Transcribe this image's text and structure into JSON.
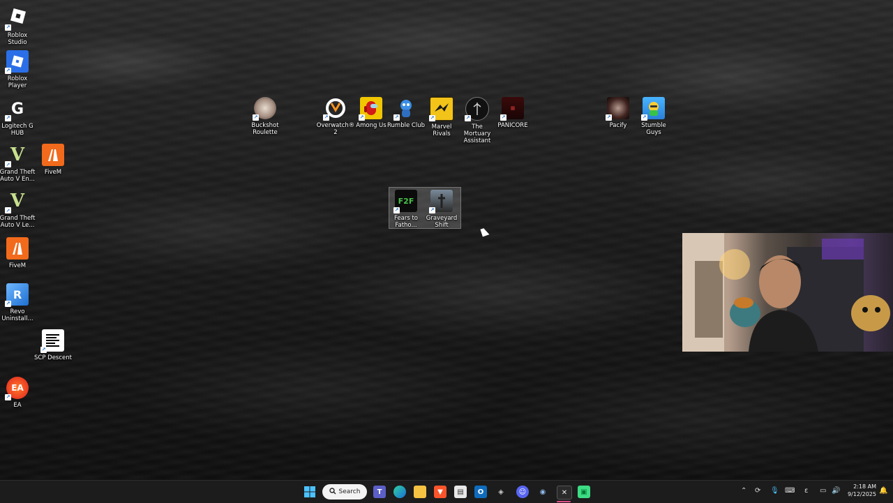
{
  "desktop": {
    "left_icons": [
      {
        "label": "Roblox Studio",
        "icon": "roblox-studio-icon"
      },
      {
        "label": "Roblox Player",
        "icon": "roblox-player-icon"
      },
      {
        "label": "Logitech G HUB",
        "icon": "logitech-g-hub-icon"
      },
      {
        "label": "Grand Theft Auto V En...",
        "icon": "gta-v-icon"
      },
      {
        "label": "FiveM",
        "icon": "fivem-icon"
      },
      {
        "label": "Grand Theft Auto V Le...",
        "icon": "gta-v-icon"
      },
      {
        "label": "FiveM",
        "icon": "fivem-icon"
      },
      {
        "label": "Revo Uninstall...",
        "icon": "revo-uninstaller-icon"
      },
      {
        "label": "SCP Descent",
        "icon": "scp-descent-icon"
      },
      {
        "label": "EA",
        "icon": "ea-icon"
      }
    ],
    "top_icons": [
      {
        "label": "Buckshot Roulette",
        "icon": "buckshot-roulette-icon"
      },
      {
        "label": "Overwatch® 2",
        "icon": "overwatch-icon"
      },
      {
        "label": "Among Us",
        "icon": "among-us-icon"
      },
      {
        "label": "Rumble Club",
        "icon": "rumble-club-icon"
      },
      {
        "label": "Marvel Rivals",
        "icon": "marvel-rivals-icon"
      },
      {
        "label": "The Mortuary Assistant",
        "icon": "mortuary-assistant-icon"
      },
      {
        "label": "PANICORE",
        "icon": "panicore-icon"
      },
      {
        "label": "Pacify",
        "icon": "pacify-icon"
      },
      {
        "label": "Stumble Guys",
        "icon": "stumble-guys-icon"
      }
    ],
    "selected_icons": [
      {
        "label": "Fears to Fatho...",
        "icon": "fears-to-fathom-icon",
        "badge": "F2F"
      },
      {
        "label": "Graveyard Shift",
        "icon": "graveyard-shift-icon"
      }
    ]
  },
  "taskbar": {
    "search_label": "Search",
    "pinned": [
      "windows-start-icon",
      "teams-icon",
      "edge-icon",
      "file-explorer-icon",
      "brave-icon",
      "microsoft-store-icon",
      "outlook-icon",
      "unity-hub-icon",
      "discord-icon",
      "steam-icon",
      "terminal-icon",
      "android-studio-icon"
    ],
    "tray_lang": "ε",
    "time": "2:18 AM",
    "date": "9/12/2025"
  }
}
